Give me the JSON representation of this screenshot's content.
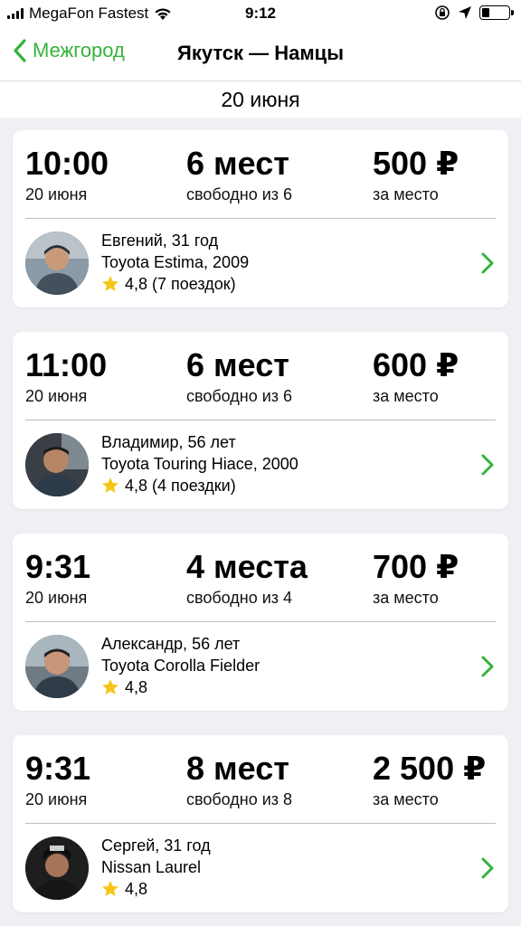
{
  "status_bar": {
    "carrier": "MegaFon Fastest",
    "time": "9:12",
    "battery_level": 0.25
  },
  "nav": {
    "back_label": "Межгород",
    "title": "Якутск — Намцы"
  },
  "date_header": "20 июня",
  "colors": {
    "accent": "#34b33a",
    "star": "#f5c518",
    "background": "#efeff4"
  },
  "trips": [
    {
      "time": "10:00",
      "date": "20 июня",
      "seats": "6 мест",
      "seats_sub": "свободно из 6",
      "price": "500 ₽",
      "price_sub": "за место",
      "driver": "Евгений, 31 год",
      "car": "Toyota Estima, 2009",
      "rating": "4,8 (7 поездок)"
    },
    {
      "time": "11:00",
      "date": "20 июня",
      "seats": "6 мест",
      "seats_sub": "свободно из 6",
      "price": "600 ₽",
      "price_sub": "за место",
      "driver": "Владимир, 56 лет",
      "car": "Toyota Touring Hiace, 2000",
      "rating": "4,8 (4 поездки)"
    },
    {
      "time": "9:31",
      "date": "20 июня",
      "seats": "4 места",
      "seats_sub": "свободно из 4",
      "price": "700 ₽",
      "price_sub": "за место",
      "driver": "Александр, 56 лет",
      "car": "Toyota Corolla Fielder",
      "rating": "4,8"
    },
    {
      "time": "9:31",
      "date": "20 июня",
      "seats": "8 мест",
      "seats_sub": "свободно из 8",
      "price": "2 500 ₽",
      "price_sub": "за место",
      "driver": "Сергей, 31 год",
      "car": "Nissan Laurel",
      "rating": "4,8"
    }
  ]
}
